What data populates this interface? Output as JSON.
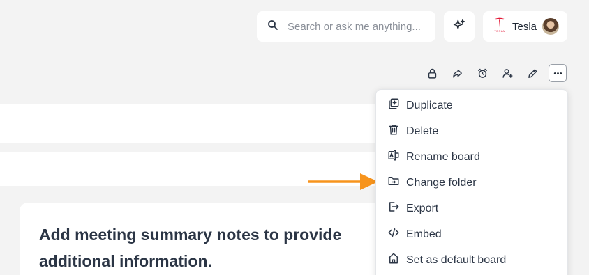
{
  "header": {
    "search_placeholder": "Search or ask me anything...",
    "account_name": "Tesla",
    "logo_word": "TESLA"
  },
  "toolbar": {
    "icons": [
      "lock-icon",
      "share-icon",
      "alarm-icon",
      "add-user-icon",
      "pencil-icon",
      "more-icon"
    ]
  },
  "menu": {
    "items": [
      {
        "label": "Duplicate",
        "icon": "duplicate-icon"
      },
      {
        "label": "Delete",
        "icon": "trash-icon"
      },
      {
        "label": "Rename board",
        "icon": "rename-icon"
      },
      {
        "label": "Change folder",
        "icon": "folder-icon"
      },
      {
        "label": "Export",
        "icon": "export-icon"
      },
      {
        "label": "Embed",
        "icon": "code-icon"
      },
      {
        "label": "Set as default board",
        "icon": "home-icon"
      }
    ]
  },
  "card": {
    "text": "Add meeting summary notes to provide additional information."
  },
  "colors": {
    "accent_arrow": "#f7941d",
    "brand_red": "#e31937",
    "background": "#f3f3f3"
  }
}
